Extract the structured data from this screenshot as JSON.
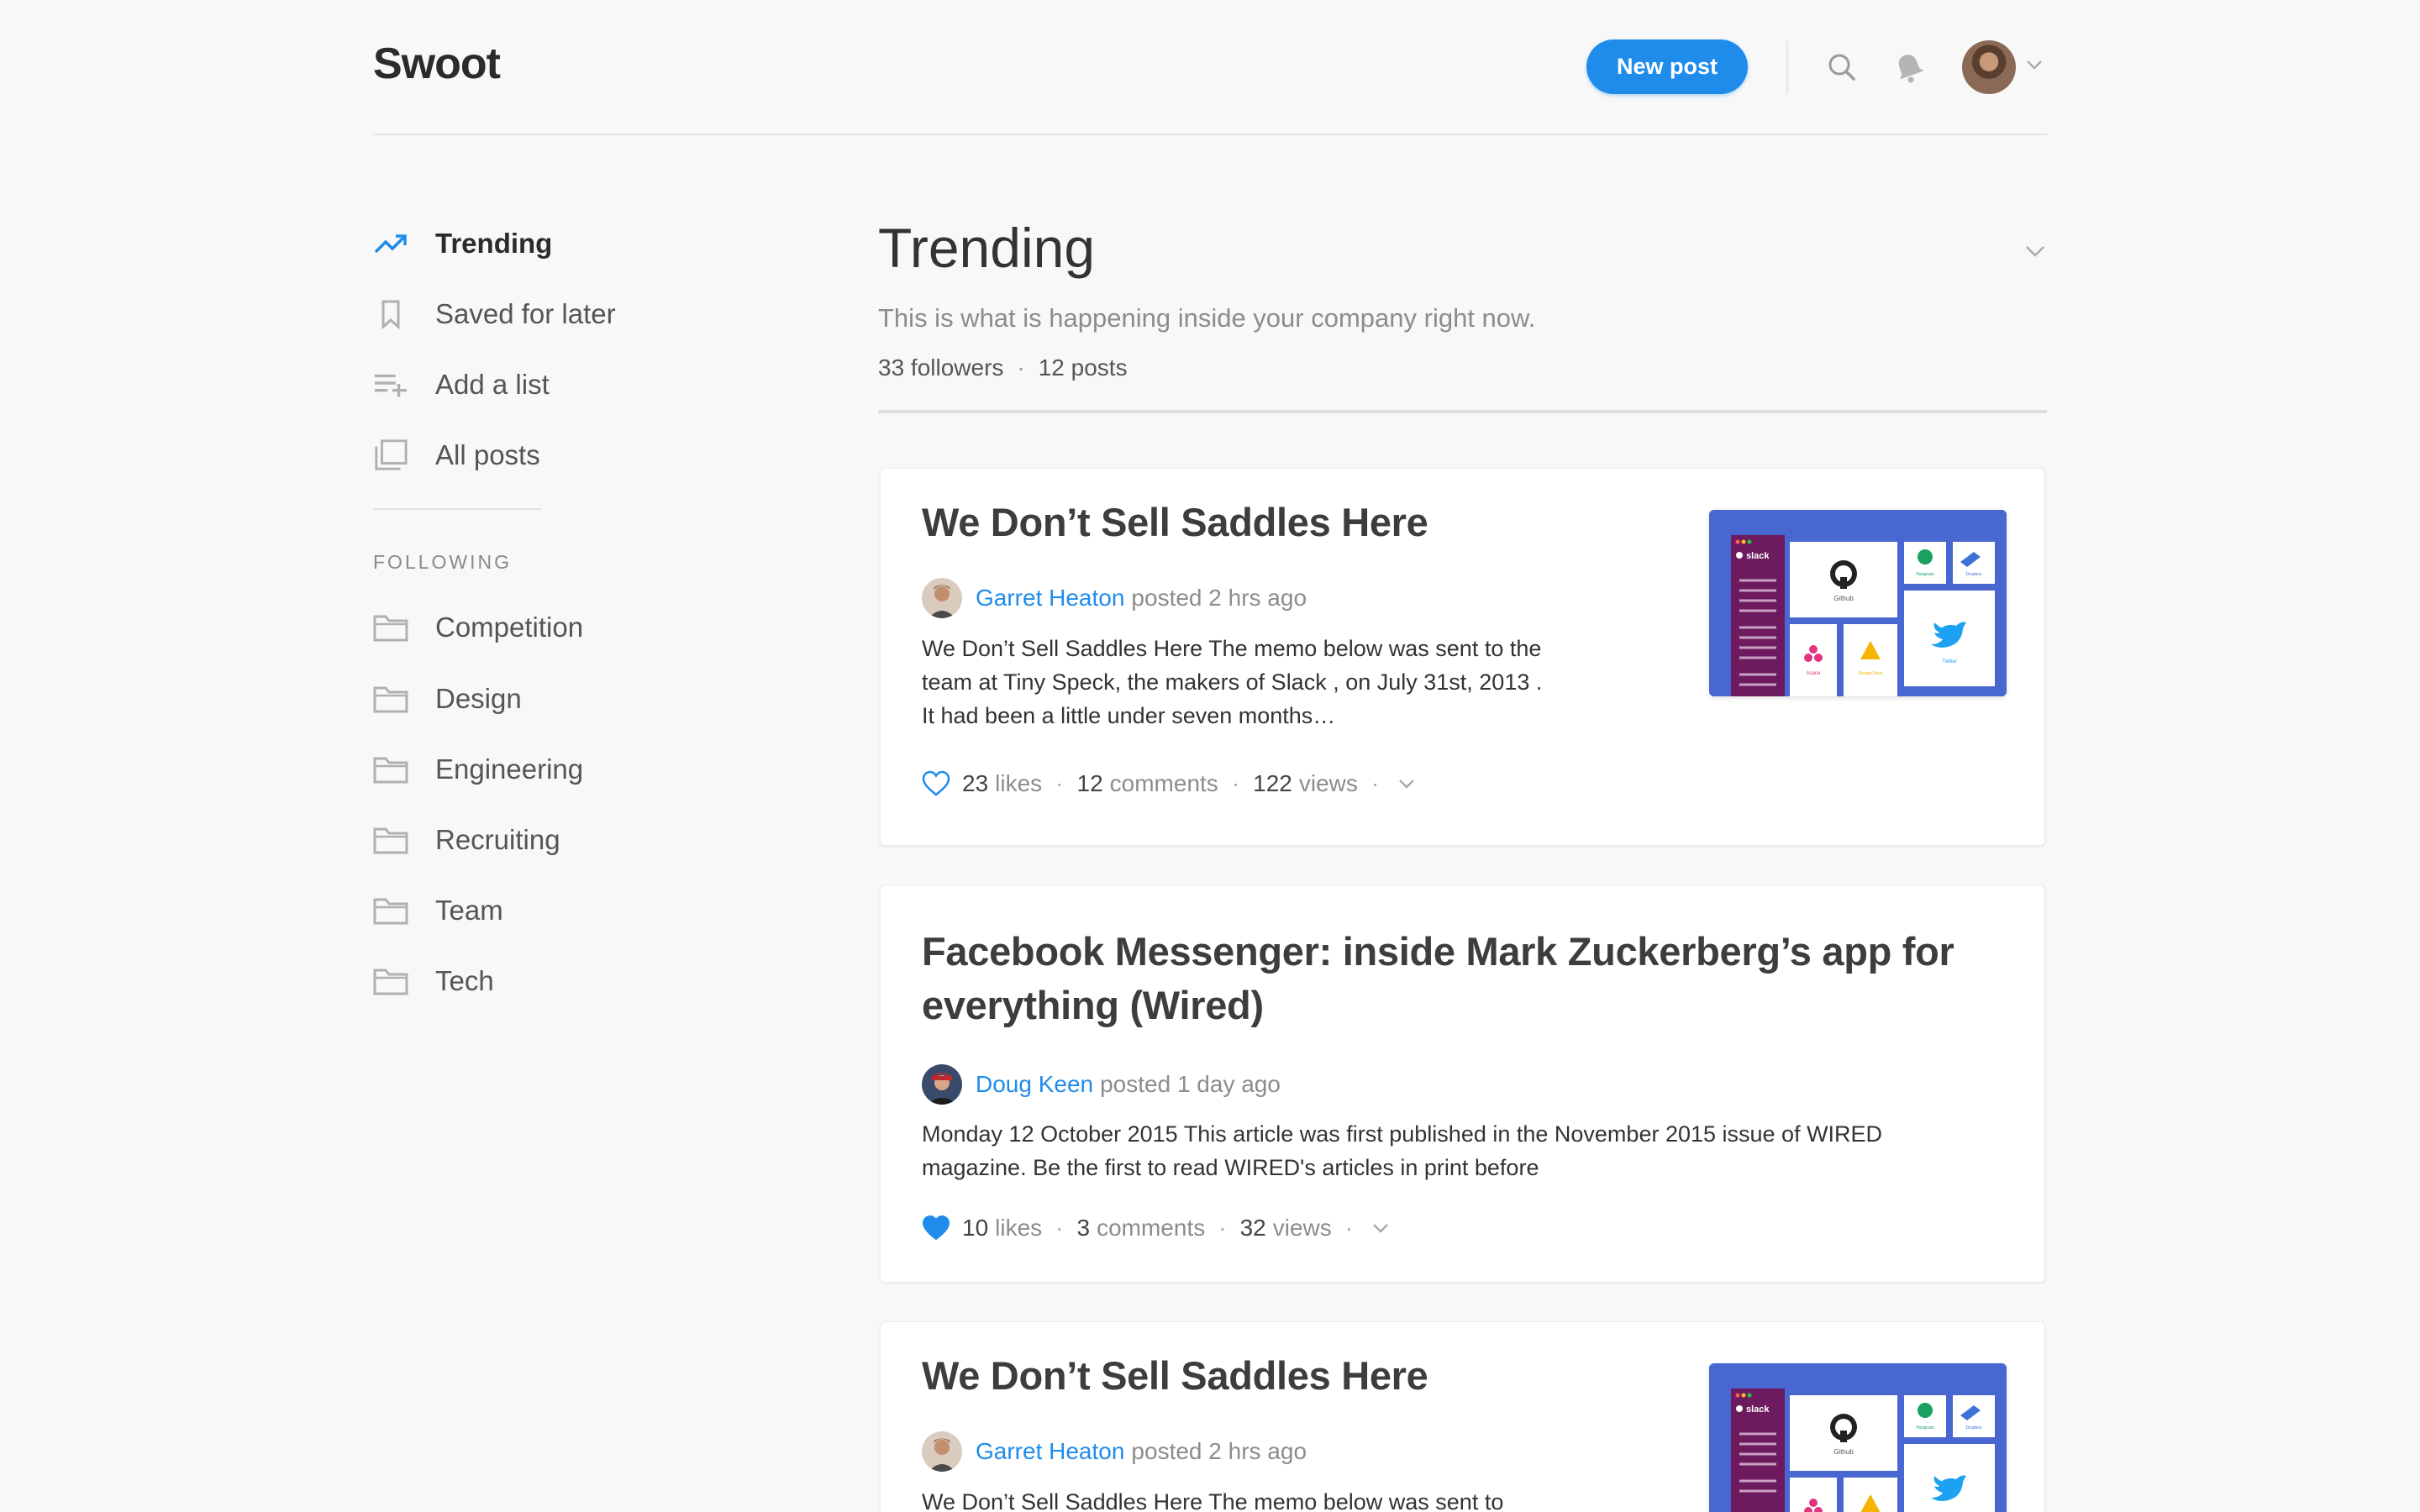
{
  "header": {
    "logo": "Swoot",
    "new_post_label": "New post"
  },
  "sidebar": {
    "nav": [
      {
        "label": "Trending",
        "icon": "trending-icon",
        "active": true
      },
      {
        "label": "Saved for later",
        "icon": "bookmark-icon"
      },
      {
        "label": "Add a list",
        "icon": "add-list-icon"
      },
      {
        "label": "All posts",
        "icon": "all-posts-icon"
      }
    ],
    "following_title": "FOLLOWING",
    "following": [
      {
        "label": "Competition",
        "icon": "folder-icon"
      },
      {
        "label": "Design",
        "icon": "folder-icon"
      },
      {
        "label": "Engineering",
        "icon": "folder-icon"
      },
      {
        "label": "Recruiting",
        "icon": "folder-icon"
      },
      {
        "label": "Team",
        "icon": "folder-icon"
      },
      {
        "label": "Tech",
        "icon": "folder-icon"
      }
    ]
  },
  "main": {
    "title": "Trending",
    "subtitle": "This is what is happening inside your company right now.",
    "followers": "33 followers",
    "posts": "12 posts",
    "dot": "·"
  },
  "posts": [
    {
      "title": "We Don’t Sell Saddles Here",
      "author": "Garret Heaton",
      "meta": "posted 2 hrs ago",
      "excerpt": "We Don’t Sell Saddles Here The memo below was sent to the team at Tiny Speck, the makers of Slack , on July 31st, 2013 . It had been a little under seven months…",
      "likes": "23",
      "likes_word": "likes",
      "comments": "12",
      "comments_word": "comments",
      "views": "122",
      "views_word": "views",
      "liked": false
    },
    {
      "title": "Facebook Messenger: inside Mark Zuckerberg’s app for everything (Wired)",
      "author": "Doug Keen",
      "meta": "posted 1 day ago",
      "excerpt": "Monday 12 October 2015 This article was first published in the November 2015 issue of WIRED magazine. Be the first to read WIRED's articles in print before",
      "likes": "10",
      "likes_word": "likes",
      "comments": "3",
      "comments_word": "comments",
      "views": "32",
      "views_word": "views",
      "liked": true
    },
    {
      "title": "We Don’t Sell Saddles Here",
      "author": "Garret Heaton",
      "meta": "posted 2 hrs ago",
      "excerpt": "We Don’t Sell Saddles Here The memo below was sent to"
    }
  ],
  "thumbnail": {
    "app_name": "slack",
    "tiles": [
      "Github",
      "Hangouts",
      "Dropbox",
      "Asana",
      "Google Drive",
      "Twitter"
    ]
  },
  "colors": {
    "accent": "#1f8ceb",
    "slack_purple": "#6d1a5f",
    "thumb_bg": "#4967d0"
  }
}
